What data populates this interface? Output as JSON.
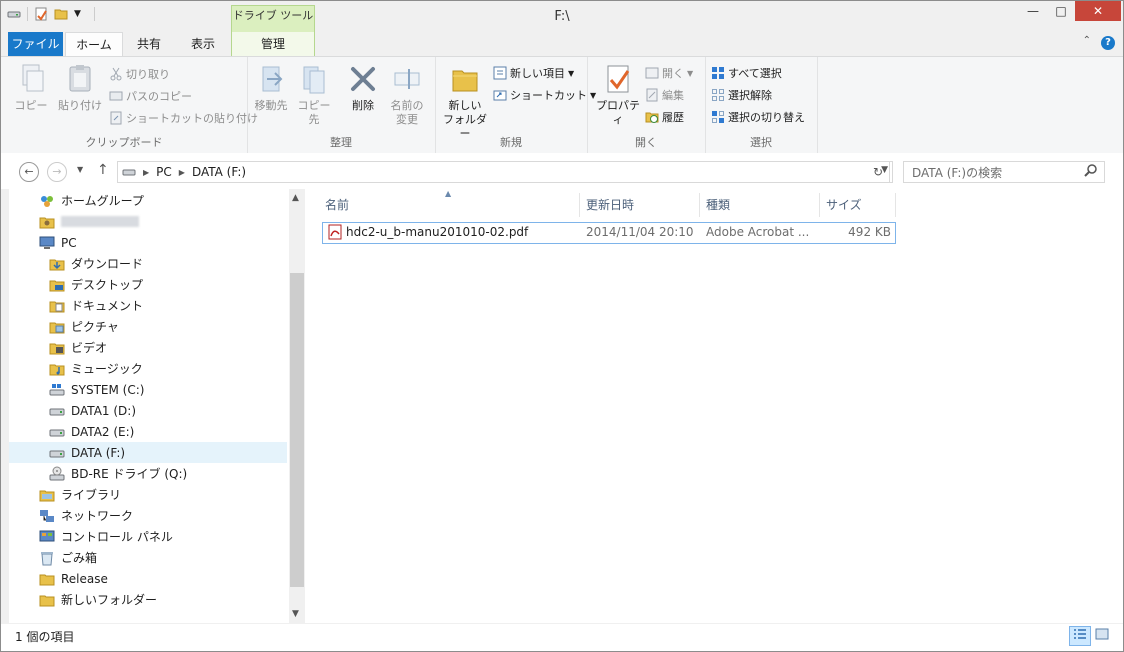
{
  "window": {
    "title": "F:\\"
  },
  "ribbon_tabs": {
    "file": "ファイル",
    "home": "ホーム",
    "share": "共有",
    "view": "表示",
    "drive_tools_header": "ドライブ ツール",
    "manage": "管理"
  },
  "clipboard": {
    "copy": "コピー",
    "paste": "貼り付け",
    "cut": "切り取り",
    "copy_path": "パスのコピー",
    "paste_shortcut": "ショートカットの貼り付け",
    "label": "クリップボード"
  },
  "organize": {
    "move_to": "移動先",
    "copy_to": "コピー先",
    "delete": "削除",
    "rename_1": "名前の",
    "rename_2": "変更",
    "label": "整理"
  },
  "new": {
    "new_folder_1": "新しい",
    "new_folder_2": "フォルダー",
    "new_item": "新しい項目",
    "shortcut": "ショートカット",
    "label": "新規"
  },
  "open": {
    "properties": "プロパティ",
    "open": "開く",
    "edit": "編集",
    "history": "履歴",
    "label": "開く"
  },
  "select": {
    "select_all": "すべて選択",
    "select_none": "選択解除",
    "invert": "選択の切り替え",
    "label": "選択"
  },
  "address": {
    "crumb_pc": "PC",
    "crumb_drive": "DATA (F:)",
    "search_placeholder": "DATA (F:)の検索"
  },
  "nav": [
    {
      "label": "ホームグループ",
      "icon": "homegroup-icon",
      "indent": 0
    },
    {
      "label": "",
      "icon": "user-folder-icon",
      "indent": 0
    },
    {
      "label": "PC",
      "icon": "pc-icon",
      "indent": 0
    },
    {
      "label": "ダウンロード",
      "icon": "downloads-folder-icon",
      "indent": 1
    },
    {
      "label": "デスクトップ",
      "icon": "desktop-folder-icon",
      "indent": 1
    },
    {
      "label": "ドキュメント",
      "icon": "documents-folder-icon",
      "indent": 1
    },
    {
      "label": "ピクチャ",
      "icon": "pictures-folder-icon",
      "indent": 1
    },
    {
      "label": "ビデオ",
      "icon": "videos-folder-icon",
      "indent": 1
    },
    {
      "label": "ミュージック",
      "icon": "music-folder-icon",
      "indent": 1
    },
    {
      "label": "SYSTEM (C:)",
      "icon": "system-drive-icon",
      "indent": 1
    },
    {
      "label": "DATA1 (D:)",
      "icon": "drive-icon",
      "indent": 1
    },
    {
      "label": "DATA2 (E:)",
      "icon": "drive-icon",
      "indent": 1
    },
    {
      "label": "DATA (F:)",
      "icon": "drive-icon",
      "indent": 1
    },
    {
      "label": "BD-RE ドライブ (Q:)",
      "icon": "optical-drive-icon",
      "indent": 1
    },
    {
      "label": "ライブラリ",
      "icon": "libraries-icon",
      "indent": 0
    },
    {
      "label": "ネットワーク",
      "icon": "network-icon",
      "indent": 0
    },
    {
      "label": "コントロール パネル",
      "icon": "control-panel-icon",
      "indent": 0
    },
    {
      "label": "ごみ箱",
      "icon": "recycle-bin-icon",
      "indent": 0
    },
    {
      "label": "Release",
      "icon": "folder-icon",
      "indent": 0
    },
    {
      "label": "新しいフォルダー",
      "icon": "folder-icon",
      "indent": 0
    }
  ],
  "columns": {
    "name": "名前",
    "modified": "更新日時",
    "type": "種類",
    "size": "サイズ"
  },
  "files": [
    {
      "name": "hdc2-u_b-manu201010-02.pdf",
      "modified": "2014/11/04 20:10",
      "type": "Adobe Acrobat ...",
      "size": "492 KB"
    }
  ],
  "status": {
    "item_count": "1 個の項目"
  },
  "colors": {
    "accent": "#1979ca",
    "selection": "#cce8ff",
    "close": "#c7463a",
    "drive_tools": "#dbefbf"
  }
}
